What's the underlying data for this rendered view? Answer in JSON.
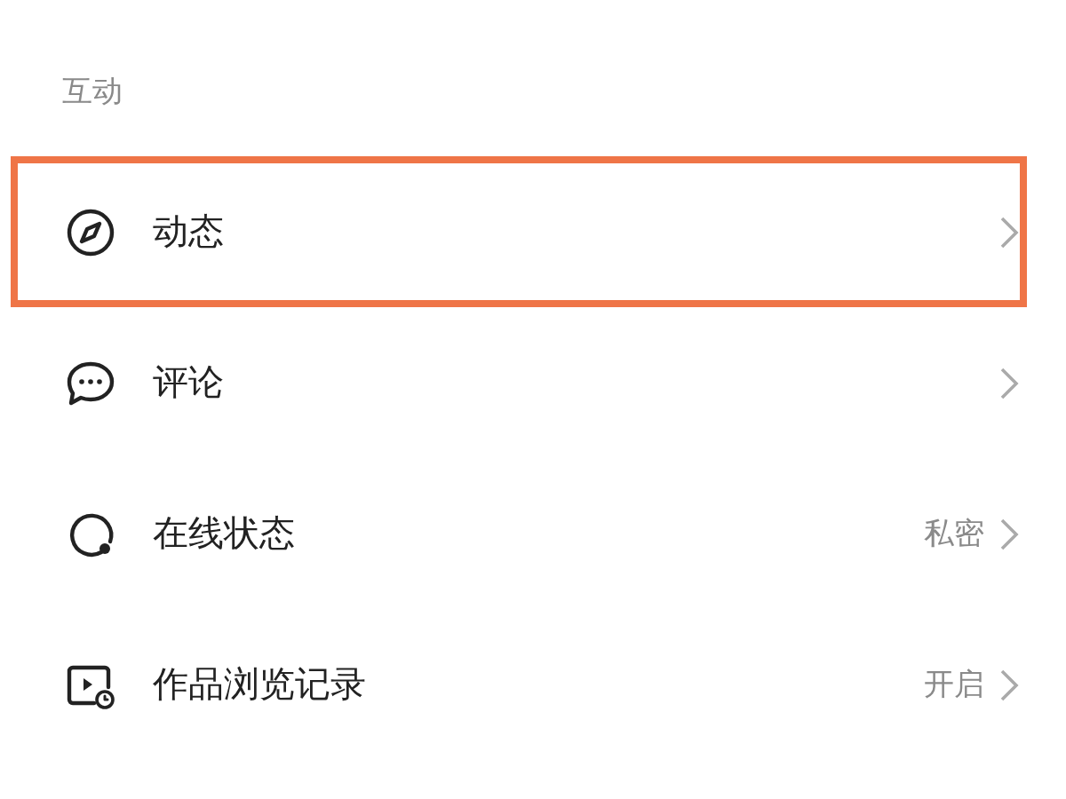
{
  "section": {
    "title": "互动"
  },
  "items": [
    {
      "kind": "compass",
      "label": "动态",
      "highlighted": true
    },
    {
      "kind": "comment",
      "label": "评论",
      "highlighted": false
    },
    {
      "kind": "status",
      "label": "在线状态",
      "value": "私密",
      "highlighted": false
    },
    {
      "kind": "history",
      "label": "作品浏览记录",
      "value": "开启",
      "highlighted": false
    }
  ]
}
